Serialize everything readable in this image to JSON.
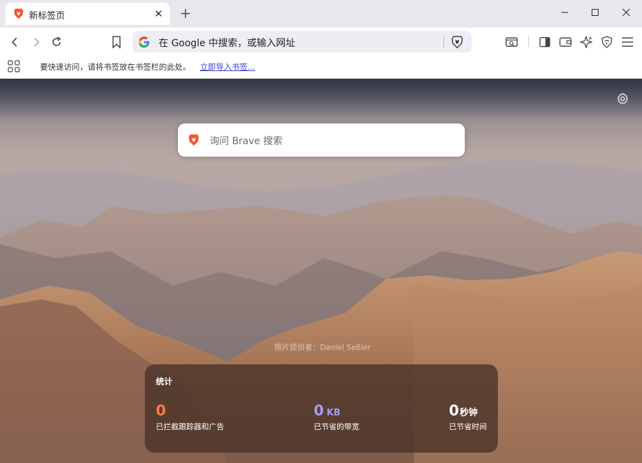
{
  "tab": {
    "title": "新标签页"
  },
  "omnibox": {
    "text": "在 Google 中搜索，或输入网址"
  },
  "bookmarks_bar": {
    "message": "要快速访问，请将书签放在书签栏的此处。",
    "import_link": "立即导入书签..."
  },
  "ntp": {
    "search_placeholder": "询问 Brave 搜索",
    "photo_credit": "照片提供者：Daniel Seßler",
    "stats": {
      "heading": "统计",
      "items": [
        {
          "value": "0",
          "unit": "",
          "label": "已拦截跟踪器和广告",
          "color": "#ff7a45"
        },
        {
          "value": "0",
          "unit": "KB",
          "label": "已节省的带宽",
          "color": "#a79bf0"
        },
        {
          "value": "0",
          "unit": "秒钟",
          "label": "已节省时间",
          "color": "#ffffff"
        }
      ]
    }
  },
  "icons": {
    "tab": [
      "brave-lion-icon",
      "close-icon",
      "plus-icon"
    ],
    "window": [
      "minimize-icon",
      "maximize-icon",
      "close-icon"
    ],
    "toolbar": [
      "back-icon",
      "forward-icon",
      "reload-icon",
      "bookmark-icon",
      "google-icon",
      "brave-shields-icon",
      "tab-search-icon",
      "sidebar-icon",
      "wallet-icon",
      "leo-ai-icon",
      "vpn-icon",
      "menu-icon"
    ],
    "ntp": [
      "settings-gear-icon",
      "brave-search-icon",
      "apps-grid-icon"
    ]
  },
  "colors": {
    "brave_orange": "#fb542b",
    "link": "#3b3fd6"
  }
}
